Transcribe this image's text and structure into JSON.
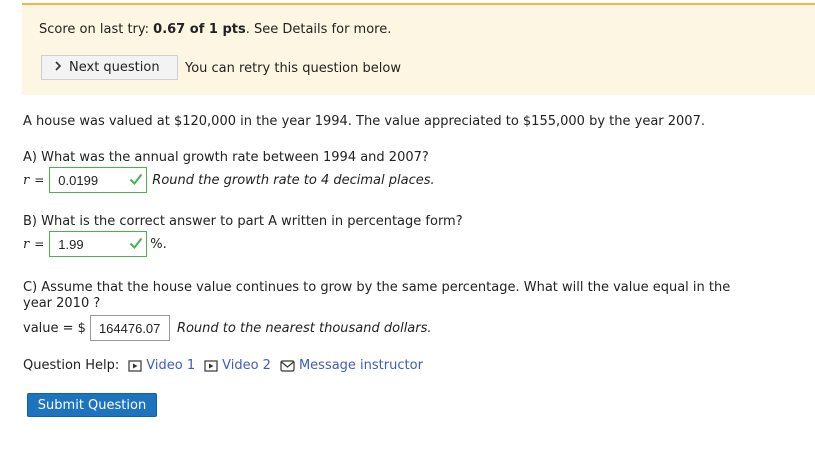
{
  "banner": {
    "score_prefix": "Score on last try: ",
    "score_value": "0.67 of 1 pts",
    "score_suffix": ". See Details for more.",
    "next_button": "Next question",
    "retry_text": "You can retry this question below"
  },
  "problem": {
    "statement": "A house was valued at $120,000 in the year 1994. The value appreciated to $155,000 by the year 2007."
  },
  "part_a": {
    "question": "A) What was the annual growth rate between 1994 and 2007?",
    "var": "r",
    "eq": "=",
    "answer": "0.0199",
    "hint": "Round the growth rate to 4 decimal places."
  },
  "part_b": {
    "question": "B) What is the correct answer to part A written in percentage form?",
    "var": "r",
    "eq": "=",
    "answer": "1.99",
    "unit": "%."
  },
  "part_c": {
    "question_line1": "C) Assume that the house value continues to grow by the same percentage. What will the value equal in the",
    "question_line2": "year 2010 ?",
    "label": "value = $",
    "answer": "164476.07",
    "hint": "Round to the nearest thousand dollars."
  },
  "help": {
    "label": "Question Help:",
    "video1": "Video 1",
    "video2": "Video 2",
    "message": "Message instructor"
  },
  "submit_label": "Submit Question",
  "colors": {
    "accent": "#1e73be",
    "correct": "#4caf50",
    "link": "#3f5cbb",
    "banner": "#fdf6e3",
    "banner_border": "#f5b443"
  },
  "icons": [
    "chevron-right-icon",
    "check-icon",
    "video-icon",
    "mail-icon"
  ]
}
